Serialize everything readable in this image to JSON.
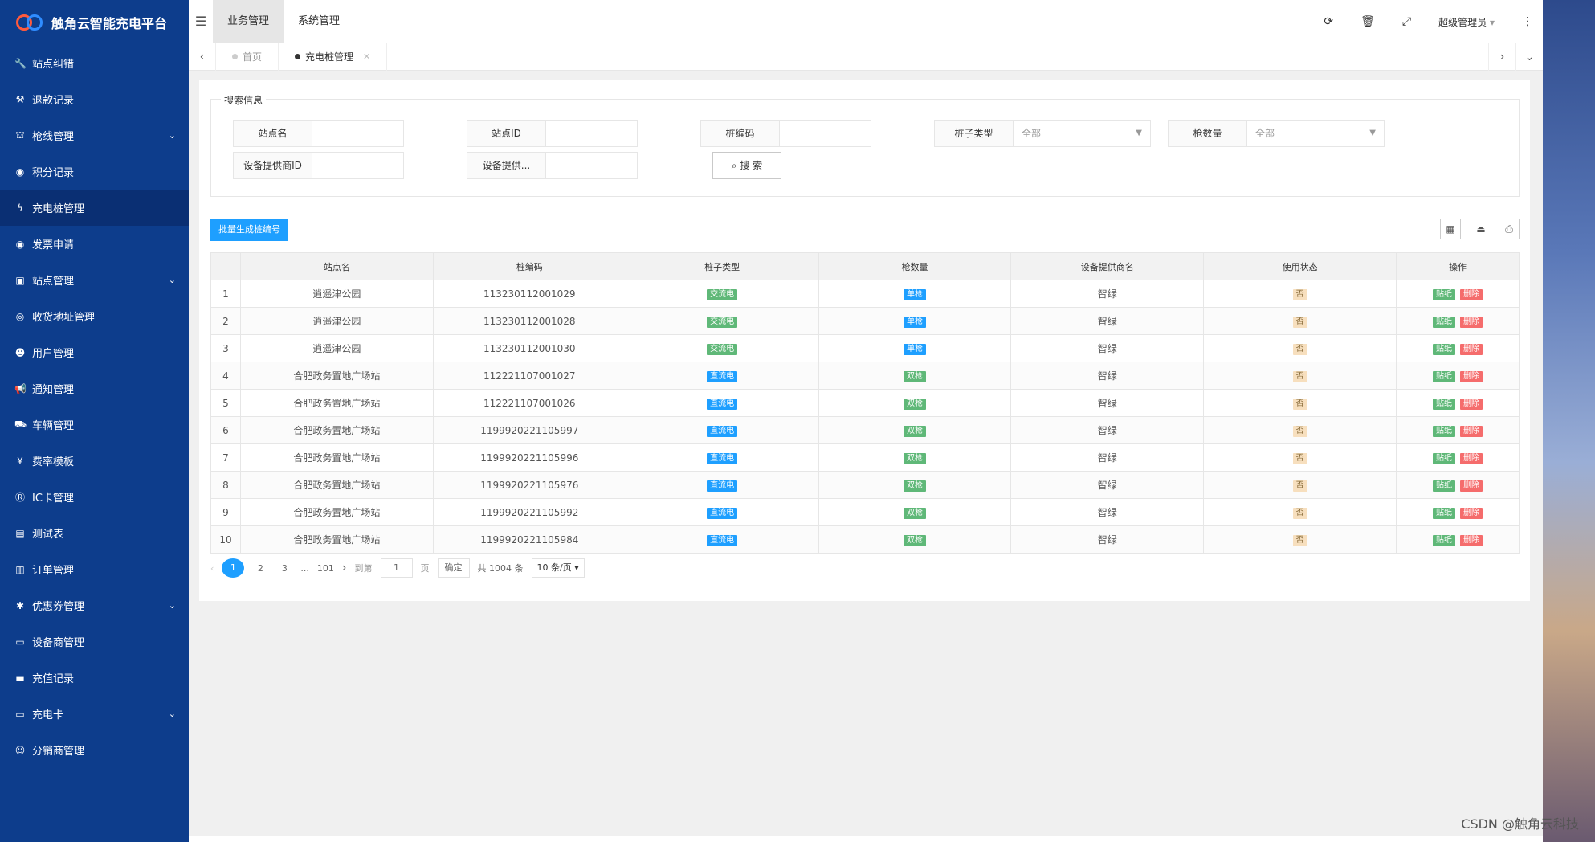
{
  "brand": {
    "title": "触角云智能充电平台"
  },
  "sidebar": {
    "items": [
      {
        "label": "站点纠错",
        "icon": "wrench-icon",
        "glyph": "🔧",
        "chevron": false,
        "active": false
      },
      {
        "label": "退款记录",
        "icon": "tools-icon",
        "glyph": "⚒",
        "chevron": false,
        "active": false
      },
      {
        "label": "枪线管理",
        "icon": "bank-icon",
        "glyph": "⛫",
        "chevron": true,
        "active": false
      },
      {
        "label": "积分记录",
        "icon": "coin-icon",
        "glyph": "◉",
        "chevron": false,
        "active": false
      },
      {
        "label": "充电桩管理",
        "icon": "charger-icon",
        "glyph": "ϟ",
        "chevron": false,
        "active": true
      },
      {
        "label": "发票申请",
        "icon": "invoice-icon",
        "glyph": "◉",
        "chevron": false,
        "active": false
      },
      {
        "label": "站点管理",
        "icon": "station-icon",
        "glyph": "▣",
        "chevron": true,
        "active": false
      },
      {
        "label": "收货地址管理",
        "icon": "address-icon",
        "glyph": "◎",
        "chevron": false,
        "active": false
      },
      {
        "label": "用户管理",
        "icon": "user-icon",
        "glyph": "☻",
        "chevron": false,
        "active": false
      },
      {
        "label": "通知管理",
        "icon": "bullhorn-icon",
        "glyph": "📢",
        "chevron": false,
        "active": false
      },
      {
        "label": "车辆管理",
        "icon": "car-icon",
        "glyph": "⛟",
        "chevron": false,
        "active": false
      },
      {
        "label": "费率模板",
        "icon": "yen-icon",
        "glyph": "¥",
        "chevron": false,
        "active": false
      },
      {
        "label": "IC卡管理",
        "icon": "card-icon",
        "glyph": "Ⓡ",
        "chevron": false,
        "active": false
      },
      {
        "label": "测试表",
        "icon": "table-icon",
        "glyph": "▤",
        "chevron": false,
        "active": false
      },
      {
        "label": "订单管理",
        "icon": "order-icon",
        "glyph": "▥",
        "chevron": false,
        "active": false
      },
      {
        "label": "优惠券管理",
        "icon": "coupon-icon",
        "glyph": "✱",
        "chevron": true,
        "active": false
      },
      {
        "label": "设备商管理",
        "icon": "device-icon",
        "glyph": "▭",
        "chevron": false,
        "active": false
      },
      {
        "label": "充值记录",
        "icon": "visa-icon",
        "glyph": "▬",
        "chevron": false,
        "active": false
      },
      {
        "label": "充电卡",
        "icon": "credit-card-icon",
        "glyph": "▭",
        "chevron": true,
        "active": false
      },
      {
        "label": "分销商管理",
        "icon": "user-plus-icon",
        "glyph": "☺",
        "chevron": false,
        "active": false
      }
    ]
  },
  "header": {
    "tabs": [
      "业务管理",
      "系统管理"
    ],
    "user": "超级管理员"
  },
  "tabsbar": {
    "home": "首页",
    "current": "充电桩管理"
  },
  "search": {
    "legend": "搜索信息",
    "fields": {
      "station_name": {
        "label": "站点名",
        "value": ""
      },
      "station_id": {
        "label": "站点ID",
        "value": ""
      },
      "pile_code": {
        "label": "桩编码",
        "value": ""
      },
      "pile_type": {
        "label": "桩子类型",
        "value": "全部"
      },
      "gun_count": {
        "label": "枪数量",
        "value": "全部"
      },
      "provider_id": {
        "label": "设备提供商ID",
        "value": ""
      },
      "provider": {
        "label": "设备提供...",
        "value": ""
      }
    },
    "button": "搜 索"
  },
  "actions": {
    "batch": "批量生成桩编号"
  },
  "table": {
    "headers": [
      "",
      "站点名",
      "桩编码",
      "桩子类型",
      "枪数量",
      "设备提供商名",
      "使用状态",
      "操作"
    ],
    "op_labels": {
      "sticker": "贴纸",
      "delete": "删除"
    },
    "rows": [
      {
        "no": "1",
        "station": "逍遥津公园",
        "code": "113230112001029",
        "type": "交流电",
        "guns": "单枪",
        "provider": "智绿",
        "status": "否"
      },
      {
        "no": "2",
        "station": "逍遥津公园",
        "code": "113230112001028",
        "type": "交流电",
        "guns": "单枪",
        "provider": "智绿",
        "status": "否"
      },
      {
        "no": "3",
        "station": "逍遥津公园",
        "code": "113230112001030",
        "type": "交流电",
        "guns": "单枪",
        "provider": "智绿",
        "status": "否"
      },
      {
        "no": "4",
        "station": "合肥政务置地广场站",
        "code": "112221107001027",
        "type": "直流电",
        "guns": "双枪",
        "provider": "智绿",
        "status": "否"
      },
      {
        "no": "5",
        "station": "合肥政务置地广场站",
        "code": "112221107001026",
        "type": "直流电",
        "guns": "双枪",
        "provider": "智绿",
        "status": "否"
      },
      {
        "no": "6",
        "station": "合肥政务置地广场站",
        "code": "1199920221105997",
        "type": "直流电",
        "guns": "双枪",
        "provider": "智绿",
        "status": "否"
      },
      {
        "no": "7",
        "station": "合肥政务置地广场站",
        "code": "1199920221105996",
        "type": "直流电",
        "guns": "双枪",
        "provider": "智绿",
        "status": "否"
      },
      {
        "no": "8",
        "station": "合肥政务置地广场站",
        "code": "1199920221105976",
        "type": "直流电",
        "guns": "双枪",
        "provider": "智绿",
        "status": "否"
      },
      {
        "no": "9",
        "station": "合肥政务置地广场站",
        "code": "1199920221105992",
        "type": "直流电",
        "guns": "双枪",
        "provider": "智绿",
        "status": "否"
      },
      {
        "no": "10",
        "station": "合肥政务置地广场站",
        "code": "1199920221105984",
        "type": "直流电",
        "guns": "双枪",
        "provider": "智绿",
        "status": "否"
      }
    ]
  },
  "pager": {
    "pages": [
      "1",
      "2",
      "3"
    ],
    "ellipsis": "...",
    "last": "101",
    "goto_label": "到第",
    "goto_value": "1",
    "page_unit": "页",
    "confirm": "确定",
    "total": "共 1004 条",
    "per_page": "10 条/页"
  },
  "watermark": "CSDN @触角云科技",
  "colors": {
    "sidebar": "#0d3d8c",
    "primary": "#1e9fff",
    "green": "#5fb878",
    "red": "#f56c6c"
  }
}
